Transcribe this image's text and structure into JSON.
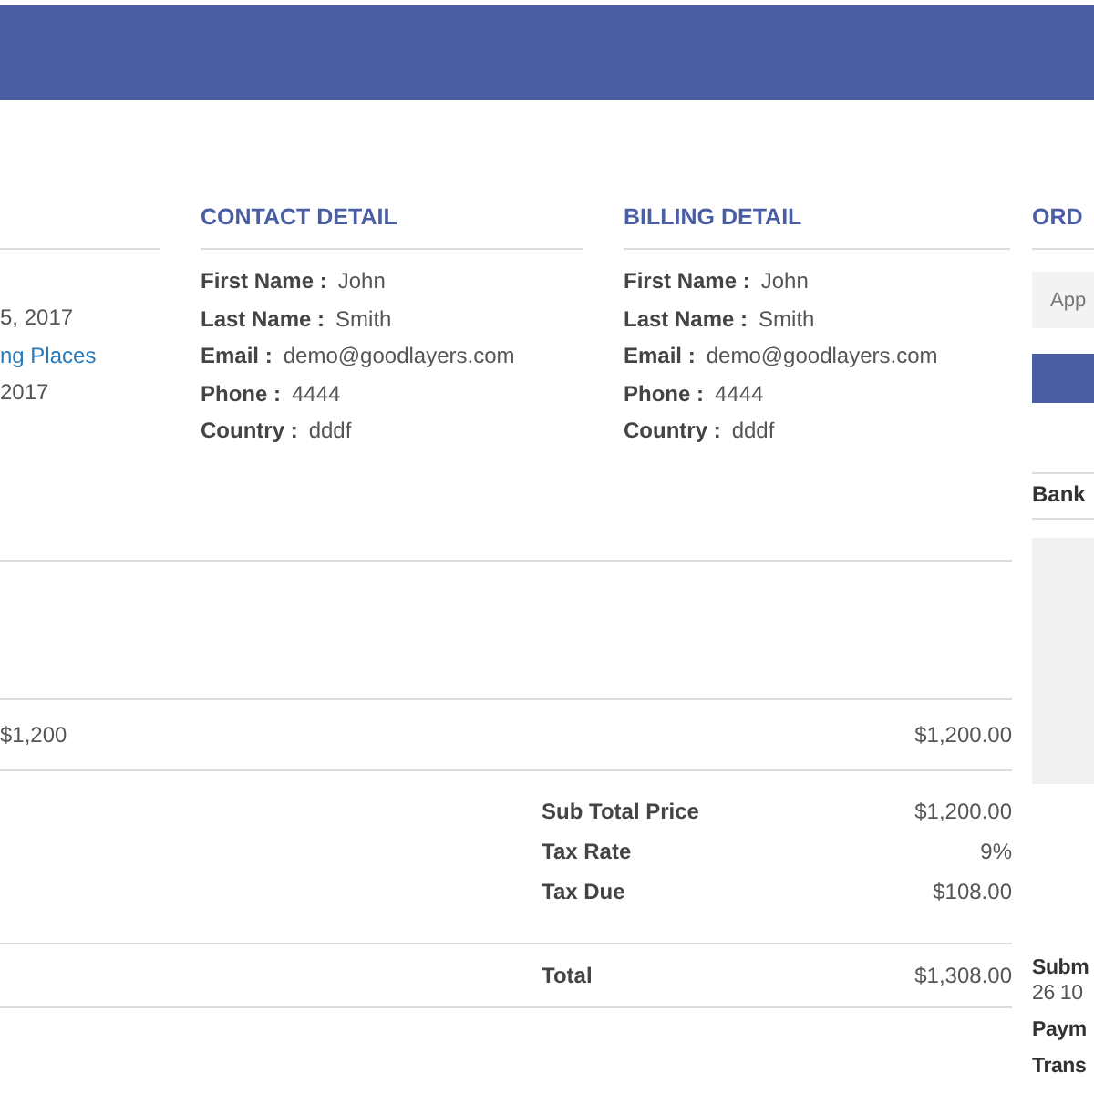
{
  "left_column": {
    "rows": [
      {
        "text": "5, 2017",
        "kind": "text"
      },
      {
        "text": "ng Places",
        "kind": "link"
      },
      {
        "text": "2017",
        "kind": "text"
      }
    ]
  },
  "contact_detail": {
    "title": "CONTACT DETAIL",
    "fields": [
      {
        "label": "First Name :",
        "value": "John"
      },
      {
        "label": "Last Name :",
        "value": "Smith"
      },
      {
        "label": "Email :",
        "value": "demo@goodlayers.com"
      },
      {
        "label": "Phone :",
        "value": "4444"
      },
      {
        "label": "Country :",
        "value": "dddf"
      }
    ]
  },
  "billing_detail": {
    "title": "BILLING DETAIL",
    "fields": [
      {
        "label": "First Name :",
        "value": "John"
      },
      {
        "label": "Last Name :",
        "value": "Smith"
      },
      {
        "label": "Email :",
        "value": "demo@goodlayers.com"
      },
      {
        "label": "Phone :",
        "value": "4444"
      },
      {
        "label": "Country :",
        "value": "dddf"
      }
    ]
  },
  "items": [
    {
      "column_1": "$1,200",
      "column_2": "$1,200.00"
    }
  ],
  "summary": [
    {
      "label": "Sub Total Price",
      "value": "$1,200.00"
    },
    {
      "label": "Tax Rate",
      "value": "9%"
    },
    {
      "label": "Tax Due",
      "value": "$108.00"
    }
  ],
  "total": {
    "label": "Total",
    "value": "$1,308.00"
  },
  "order_column": {
    "title": "ORD",
    "coupon_field": {
      "placeholder": "App"
    },
    "bank_title": "Bank",
    "details": [
      {
        "text": "Subm",
        "kind": "label"
      },
      {
        "text": "26 10",
        "kind": "value"
      },
      {
        "text": "Paym",
        "kind": "label"
      },
      {
        "text": "Trans",
        "kind": "label"
      }
    ]
  }
}
